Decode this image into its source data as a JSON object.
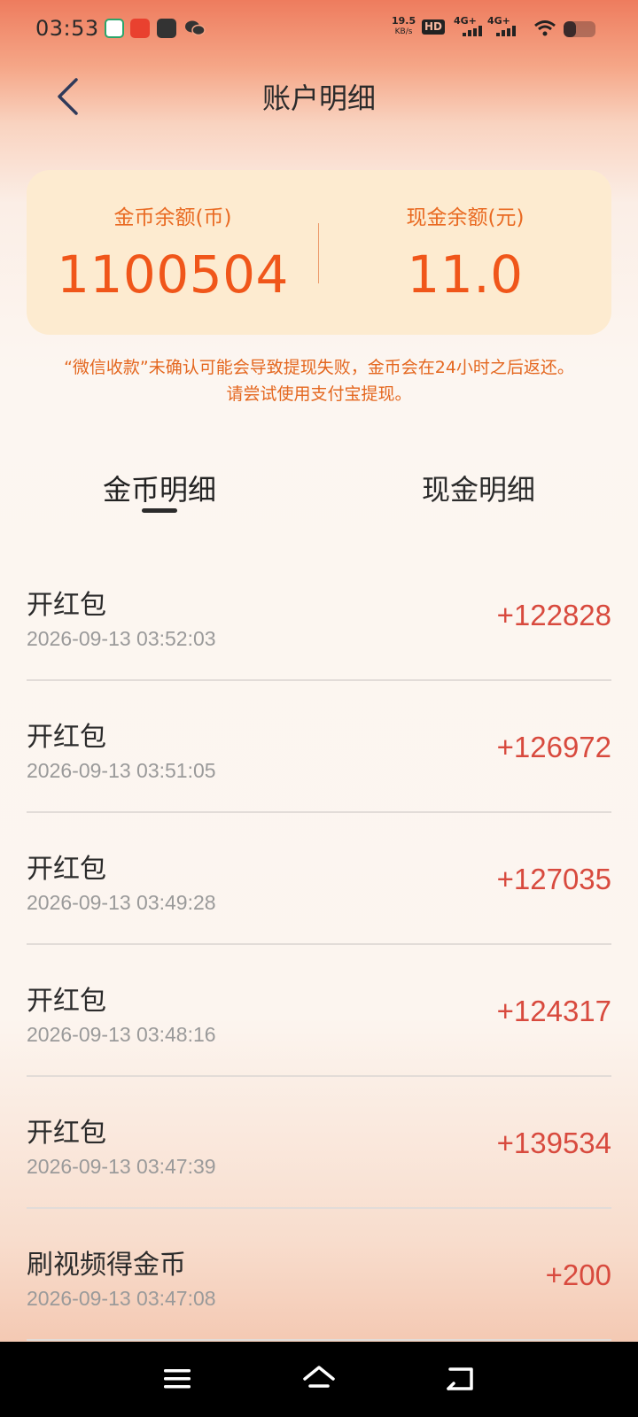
{
  "status_bar": {
    "time": "03:53",
    "net_speed": "19.5",
    "net_unit": "KB/s",
    "hd": "HD",
    "sim1": "4G+",
    "sim2": "4G+"
  },
  "header": {
    "title": "账户明细"
  },
  "balance": {
    "coin_label": "金币余额(币)",
    "coin_value": "1100504",
    "cash_label": "现金余额(元)",
    "cash_value": "11.0"
  },
  "notice": {
    "line1": "“微信收款”未确认可能会导致提现失败，金币会在24小时之后返还。",
    "line2": "请尝试使用支付宝提现。"
  },
  "tabs": {
    "coin": "金币明细",
    "cash": "现金明细",
    "active": "coin"
  },
  "records": [
    {
      "title": "开红包",
      "time": "2026-09-13 03:52:03",
      "amount": "+122828"
    },
    {
      "title": "开红包",
      "time": "2026-09-13 03:51:05",
      "amount": "+126972"
    },
    {
      "title": "开红包",
      "time": "2026-09-13 03:49:28",
      "amount": "+127035"
    },
    {
      "title": "开红包",
      "time": "2026-09-13 03:48:16",
      "amount": "+124317"
    },
    {
      "title": "开红包",
      "time": "2026-09-13 03:47:39",
      "amount": "+139534"
    },
    {
      "title": "刷视频得金币",
      "time": "2026-09-13 03:47:08",
      "amount": "+200"
    }
  ],
  "colors": {
    "accent": "#f0561a",
    "amount": "#d84a3e",
    "card_bg": "#fdebd0"
  }
}
